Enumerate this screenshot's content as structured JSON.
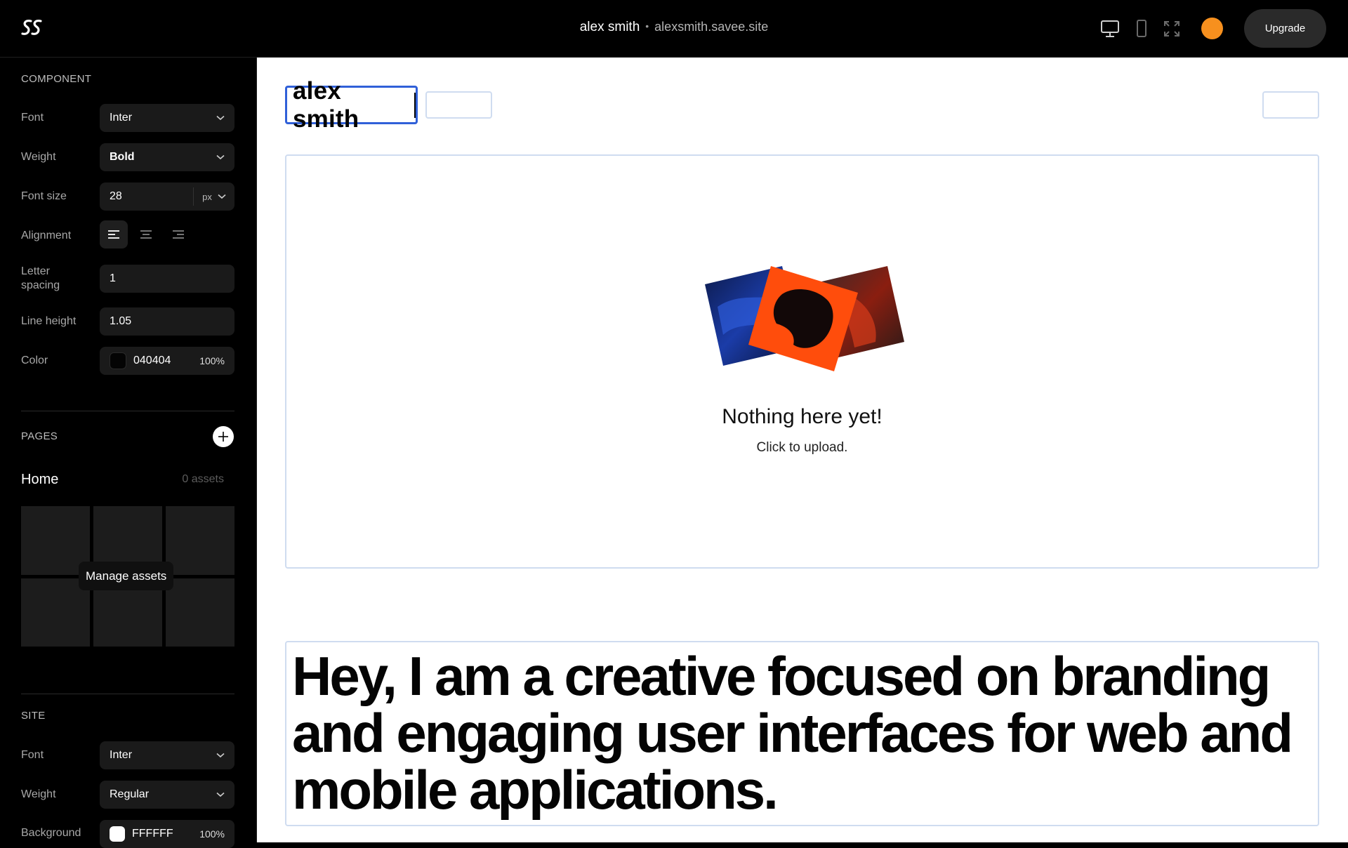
{
  "header": {
    "site_name": "alex smith",
    "separator": "•",
    "domain": "alexsmith.savee.site",
    "upgrade_label": "Upgrade",
    "icons": [
      "desktop-icon",
      "mobile-icon",
      "expand-icon"
    ],
    "avatar_color": "#f7901e"
  },
  "component": {
    "section_label": "COMPONENT",
    "font_label": "Font",
    "font_value": "Inter",
    "weight_label": "Weight",
    "weight_value": "Bold",
    "font_size_label": "Font size",
    "font_size_value": "28",
    "font_size_unit": "px",
    "alignment_label": "Alignment",
    "alignment_selected": "left",
    "letter_spacing_label_1": "Letter",
    "letter_spacing_label_2": "spacing",
    "letter_spacing_value": "1",
    "line_height_label": "Line height",
    "line_height_value": "1.05",
    "color_label": "Color",
    "color_value": "040404",
    "color_hex": "#040404",
    "color_opacity": "100%"
  },
  "pages": {
    "section_label": "PAGES",
    "items": [
      {
        "name": "Home",
        "assets": "0 assets"
      }
    ],
    "manage_assets_label": "Manage assets"
  },
  "site": {
    "section_label": "SITE",
    "font_label": "Font",
    "font_value": "Inter",
    "weight_label": "Weight",
    "weight_value": "Regular",
    "background_label": "Background",
    "background_value": "FFFFFF",
    "background_hex": "#FFFFFF",
    "background_opacity": "100%"
  },
  "canvas": {
    "name_text": "alex smith",
    "empty_title": "Nothing here yet!",
    "empty_subtitle": "Click to upload.",
    "bio_text": "Hey, I am a creative focused on branding and engaging user interfaces for web and mobile applications.",
    "accent_color": "#3060d8"
  }
}
